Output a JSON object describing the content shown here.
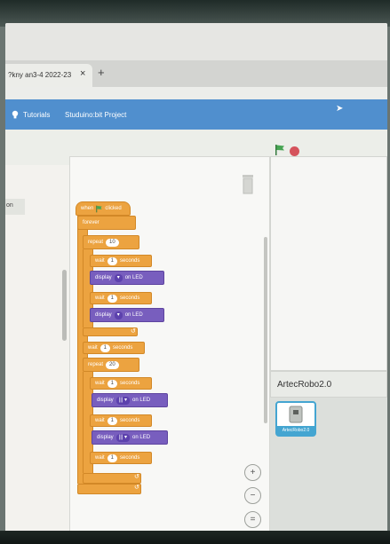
{
  "browser": {
    "tab_title": "?kny an3-4 2022-23",
    "close_glyph": "×",
    "newtab_glyph": "+"
  },
  "menubar": {
    "tutorials": "Tutorials",
    "project": "Studuino:bit Project"
  },
  "left_tab_fragment": "on",
  "script": {
    "when": "when",
    "clicked": "clicked",
    "forever": "forever",
    "repeat1_label": "repeat",
    "repeat1_value": "10",
    "wait_label": "wait",
    "seconds_label": "seconds",
    "wait_value": "1",
    "display_label": "display",
    "on_led": "on LED",
    "repeat2_value": "20",
    "led_pattern_a": "▾",
    "led_pattern_b": "|||  ▾",
    "loop_arrow": "↺"
  },
  "zoom": {
    "in": "+",
    "out": "−",
    "reset": "="
  },
  "sprite": {
    "name_header": "ArtecRobo2.0",
    "tile_label": "ArtecRobo2.0"
  },
  "colors": {
    "menubar": "#4a90d6",
    "control_orange": "#f3a234",
    "looks_purple": "#7a5dc7",
    "flag_green": "#3fa84d",
    "stop_red": "#e0505a"
  }
}
